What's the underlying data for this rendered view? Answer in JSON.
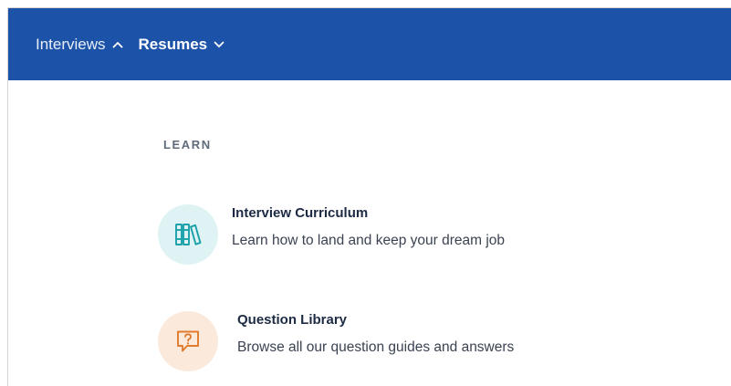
{
  "nav": {
    "items": [
      {
        "label": "Interviews",
        "chevron": "chevron-up-icon",
        "expanded": true
      },
      {
        "label": "Resumes",
        "chevron": "chevron-down-icon",
        "expanded": false
      }
    ],
    "background_color": "#1c53a8"
  },
  "learn": {
    "heading": "LEARN",
    "entries": [
      {
        "title": "Interview Curriculum",
        "description": "Learn how to land and keep your dream job",
        "icon": "books-icon",
        "icon_color": "#1aa0a8",
        "icon_bg": "#dff3f4"
      },
      {
        "title": "Question Library",
        "description": "Browse all our question guides and answers",
        "icon": "question-bubble-icon",
        "icon_color": "#e07a2c",
        "icon_bg": "#fbe9dc"
      }
    ]
  }
}
